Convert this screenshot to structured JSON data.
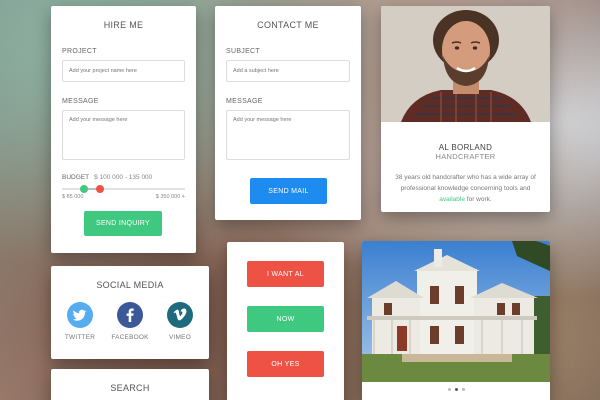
{
  "colors": {
    "green": "#3fc87f",
    "blue": "#1e8bf0",
    "red": "#ee5245",
    "twitter": "#55acee",
    "facebook": "#3b5998",
    "vimeo": "#1f6b7d"
  },
  "hire": {
    "title": "HIRE ME",
    "project_label": "PROJECT",
    "project_placeholder": "Add your project name here",
    "message_label": "MESSAGE",
    "message_placeholder": "Add your message here",
    "budget_label": "BUDGET",
    "budget_range": "$ 100 000 - 135 000",
    "slider_min": "$ 85 000",
    "slider_max": "$ 350 000 +",
    "slider_low_fraction": 0.18,
    "slider_high_fraction": 0.31,
    "button": "SEND INQUIRY"
  },
  "contact": {
    "title": "CONTACT ME",
    "subject_label": "SUBJECT",
    "subject_placeholder": "Add a subject here",
    "message_label": "MESSAGE",
    "message_placeholder": "Add your message here",
    "button": "SEND MAIL"
  },
  "profile": {
    "name": "AL BORLAND",
    "role": "HANDCRAFTER",
    "bio_before": "38 years old handcrafter who has a wide array of professional knowledge concerning tools and",
    "bio_link": "available",
    "bio_after": "for work."
  },
  "social": {
    "title": "SOCIAL MEDIA",
    "items": [
      {
        "label": "TWITTER",
        "icon": "twitter-bird-icon"
      },
      {
        "label": "FACEBOOK",
        "icon": "facebook-f-icon"
      },
      {
        "label": "VIMEO",
        "icon": "vimeo-v-icon"
      }
    ]
  },
  "search": {
    "title": "SEARCH"
  },
  "actions": {
    "buttons": [
      "I WANT AL",
      "NOW",
      "OH YES"
    ]
  },
  "gallery": {
    "slide_count": 3,
    "active_slide": 2
  }
}
